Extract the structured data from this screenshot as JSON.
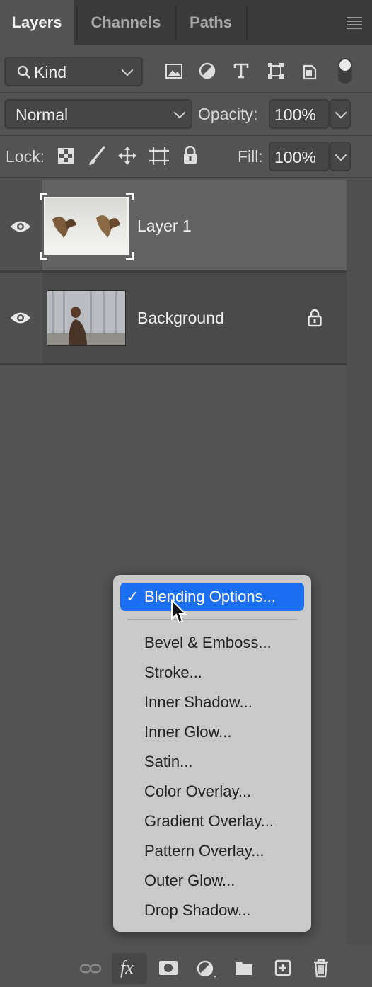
{
  "tabs": [
    {
      "label": "Layers",
      "active": true
    },
    {
      "label": "Channels",
      "active": false
    },
    {
      "label": "Paths",
      "active": false
    }
  ],
  "filter": {
    "value": "Kind",
    "icons": [
      "image-filter-icon",
      "adjustment-filter-icon",
      "type-filter-icon",
      "shape-filter-icon",
      "smart-object-filter-icon",
      "filter-toggle-icon"
    ]
  },
  "blend": {
    "mode": "Normal",
    "opacity_label": "Opacity:",
    "opacity_value": "100%"
  },
  "lock": {
    "label": "Lock:",
    "fill_label": "Fill:",
    "fill_value": "100%",
    "icons": [
      "lock-transparent-pixels-icon",
      "lock-image-pixels-icon",
      "lock-position-icon",
      "lock-artboard-icon",
      "lock-all-icon"
    ]
  },
  "layers": [
    {
      "name": "Layer 1",
      "selected": true,
      "visible": true,
      "locked": false
    },
    {
      "name": "Background",
      "selected": false,
      "visible": true,
      "locked": true
    }
  ],
  "context_menu": {
    "checked_item": "Blending Options...",
    "items": [
      "Bevel & Emboss...",
      "Stroke...",
      "Inner Shadow...",
      "Inner Glow...",
      "Satin...",
      "Color Overlay...",
      "Gradient Overlay...",
      "Pattern Overlay...",
      "Outer Glow...",
      "Drop Shadow..."
    ]
  },
  "bottom_bar": {
    "fx_label": "fx",
    "icons": [
      "link-layers-icon",
      "fx-icon",
      "add-mask-icon",
      "adjustment-layer-icon",
      "new-group-icon",
      "new-layer-icon",
      "trash-icon"
    ]
  },
  "colors": {
    "panel": "#535353",
    "highlight": "#1d6ff2",
    "menu_bg": "#c9c9c9"
  }
}
